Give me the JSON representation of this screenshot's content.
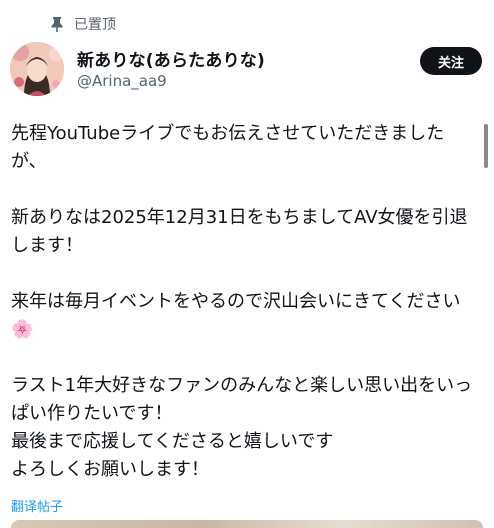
{
  "pinned": {
    "label": "已置顶"
  },
  "user": {
    "name": "新ありな(あらたありな)",
    "handle": "@Arina_aa9"
  },
  "follow_label": "关注",
  "tweet": {
    "text": "先程YouTubeライブでもお伝えさせていただきましたが、\n\n新ありなは2025年12月31日をもちましてAV女優を引退します！\n\n来年は毎月イベントをやるので沢山会いにきてください🌸\n\nラスト1年大好きなファンのみんなと楽しい思い出をいっぱい作りたいです！\n最後まで応援してくださると嬉しいです\nよろしくお願いします！"
  },
  "translate_label": "翻译帖子",
  "icons": {
    "pin": "pin-icon",
    "avatar": "profile-photo"
  },
  "colors": {
    "follow_bg": "#0f1419",
    "link": "#1d9bf0",
    "muted": "#536471"
  }
}
